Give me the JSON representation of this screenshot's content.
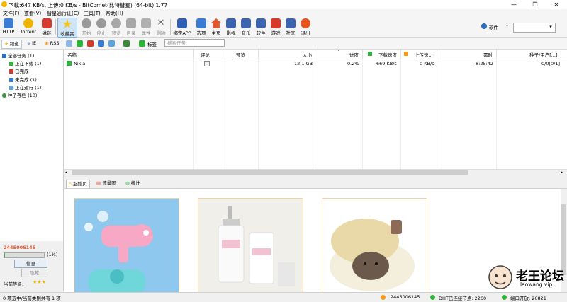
{
  "window": {
    "title": "下載:647 KB/s, 上傳:0 KB/s - BitComet(比特彗星) (64-bit) 1.77"
  },
  "menu": [
    "文件(F)",
    "查看(V)",
    "彗星通行证(C)",
    "工具(T)",
    "帮助(H)"
  ],
  "toolbar": {
    "buttons": [
      "HTTP",
      "Torrent",
      "磁链",
      "收藏夹",
      "开始",
      "停止",
      "预览",
      "目录",
      "属性",
      "删除",
      "绑定APP",
      "选项",
      "主页",
      "影视",
      "音乐",
      "软件",
      "游戏",
      "社区",
      "退出"
    ],
    "search_category": "软件"
  },
  "subbar": {
    "tabs": [
      "频道",
      "IE",
      "RSS"
    ],
    "tag_label": "标签",
    "filter_placeholder": "搜索任务"
  },
  "sidebar": {
    "items": [
      "全部任务 (1)",
      "正在下载 (1)",
      "已完成",
      "未完成 (1)",
      "正在运行 (1)",
      "种子存档 (10)"
    ],
    "account_id": "2445006145",
    "progress_text": "(1%)",
    "progress_fraction": 0.01,
    "info_button": "信息",
    "hide_button": "隐藏",
    "level_label": "当前等级:",
    "level_stars": "★★★"
  },
  "list": {
    "columns": [
      "名称",
      "评论",
      "预览",
      "大小",
      "进度",
      "下载速度",
      "上传速...",
      "需时",
      "种子/用户[...]"
    ],
    "rows": [
      {
        "name": "Nikia",
        "size": "12.1 GB",
        "progress": "0.2%",
        "down": "669 KB/s",
        "up": "0 KB/s",
        "eta": "8:25:42",
        "seeds": "0/0[0/1]"
      }
    ]
  },
  "bottom_tabs": [
    "起始页",
    "流量图",
    "统计"
  ],
  "statusbar": {
    "left": "0 项选中/当前类别共有 1 项",
    "account": "2445006145",
    "dht": "DHT已连接节点: 2260",
    "port": "端口开放: 26821"
  },
  "watermark": {
    "text": "老王论坛",
    "sub": "laowang.vip"
  },
  "colors": {
    "accent": "#2a6fc9",
    "green_status": "#2fb53a",
    "orange": "#f29b1b"
  }
}
